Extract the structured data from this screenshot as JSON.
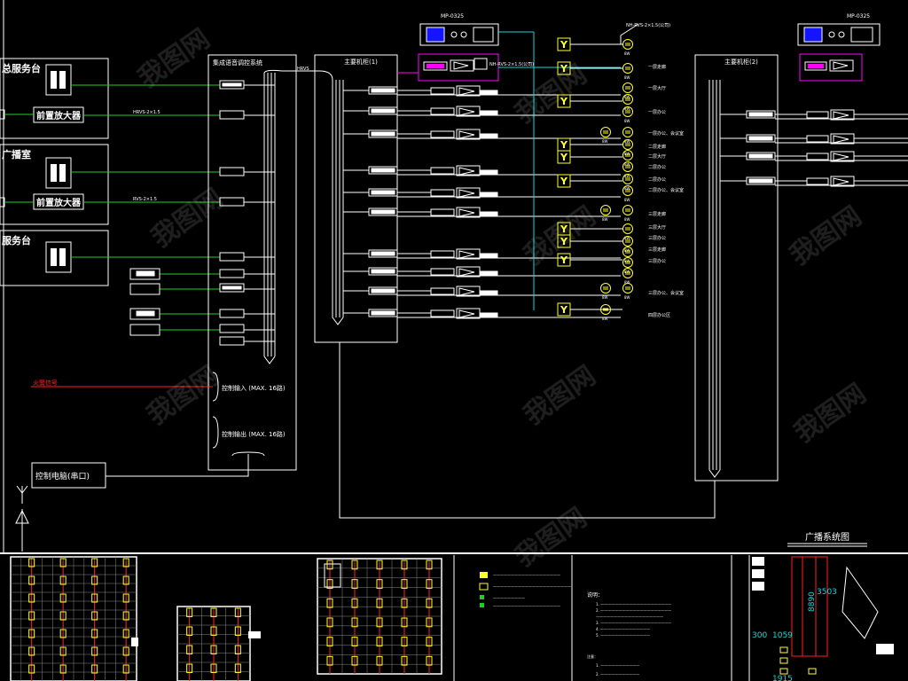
{
  "labels": {
    "service_desk_1": "总服务台",
    "broadcast_room": "广播室",
    "service_desk_3": "服务台",
    "preamp_1": "前置放大器",
    "preamp_2": "前置放大器",
    "mp_left": "MP-0325",
    "mp_right": "MP-0325",
    "rack_1_title": "主要机柜(1)",
    "rack_2_title": "主要机柜(2)",
    "central_system_title": "集成语音调控系统",
    "fire_signal": "火警信号",
    "control_input": "控制输入 (MAX. 16路)",
    "control_output": "控制输出 (MAX. 16路)",
    "control_pc": "控制电脑(串口)",
    "broadcast_diagram_title": "广播系统图",
    "cable_label_a": "HRVS-2×1.5",
    "cable_label_b": "RVS-2×1.5",
    "cable_label_top": "NH-RVS-2×1.5(公司)",
    "dim_1": "3503",
    "dim_2": "8890",
    "dim_3": "1059",
    "dim_4": "300",
    "dim_5": "1915",
    "legend_notes": "说明：",
    "watermark": "我图网"
  },
  "zone_labels": [
    "一层走廊",
    "一层大厅",
    "一层办公",
    "一层办公、会议室",
    "二层走廊",
    "二层大厅",
    "二层办公",
    "二层办公",
    "二层办公、会议室",
    "三层走廊",
    "三层大厅",
    "三层办公",
    "三层走廊",
    "三层办公",
    "三层办公、会议室",
    "四层办公区"
  ],
  "colors": {
    "green_line": "#1fd11f",
    "cyan_line": "#19d7d7",
    "magenta": "#ff00ff",
    "yellow": "#ffff2a",
    "red": "#ff2020",
    "white": "#ffffff",
    "blue_device": "#1414ff"
  },
  "icons": [
    "speaker-icon",
    "amplifier-icon",
    "antenna-icon",
    "ceiling-speaker-icon"
  ]
}
